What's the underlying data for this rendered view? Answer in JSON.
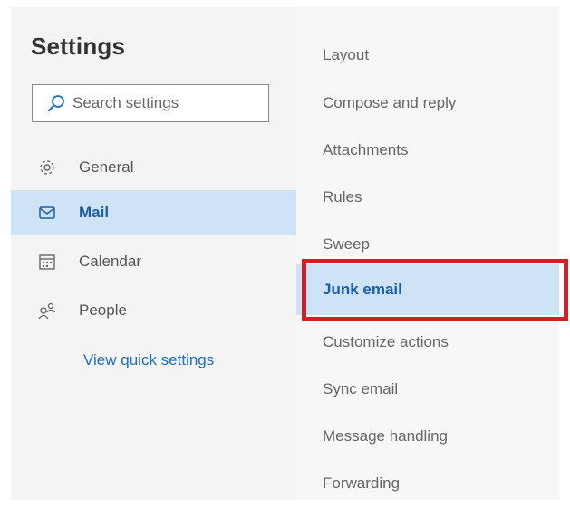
{
  "settings": {
    "title": "Settings",
    "search": {
      "placeholder": "Search settings"
    },
    "nav": [
      {
        "id": "general",
        "label": "General",
        "icon": "gear-icon"
      },
      {
        "id": "mail",
        "label": "Mail",
        "icon": "mail-icon",
        "active": true
      },
      {
        "id": "calendar",
        "label": "Calendar",
        "icon": "calendar-icon"
      },
      {
        "id": "people",
        "label": "People",
        "icon": "people-icon"
      }
    ],
    "quick_settings_label": "View quick settings"
  },
  "mail_settings": {
    "items": [
      "Layout",
      "Compose and reply",
      "Attachments",
      "Rules",
      "Sweep",
      "Junk email",
      "Customize actions",
      "Sync email",
      "Message handling",
      "Forwarding"
    ],
    "selected": "Junk email"
  },
  "colors": {
    "accent": "#1a5fa8",
    "selection": "#cfe3f6",
    "callout": "#d21f26"
  }
}
